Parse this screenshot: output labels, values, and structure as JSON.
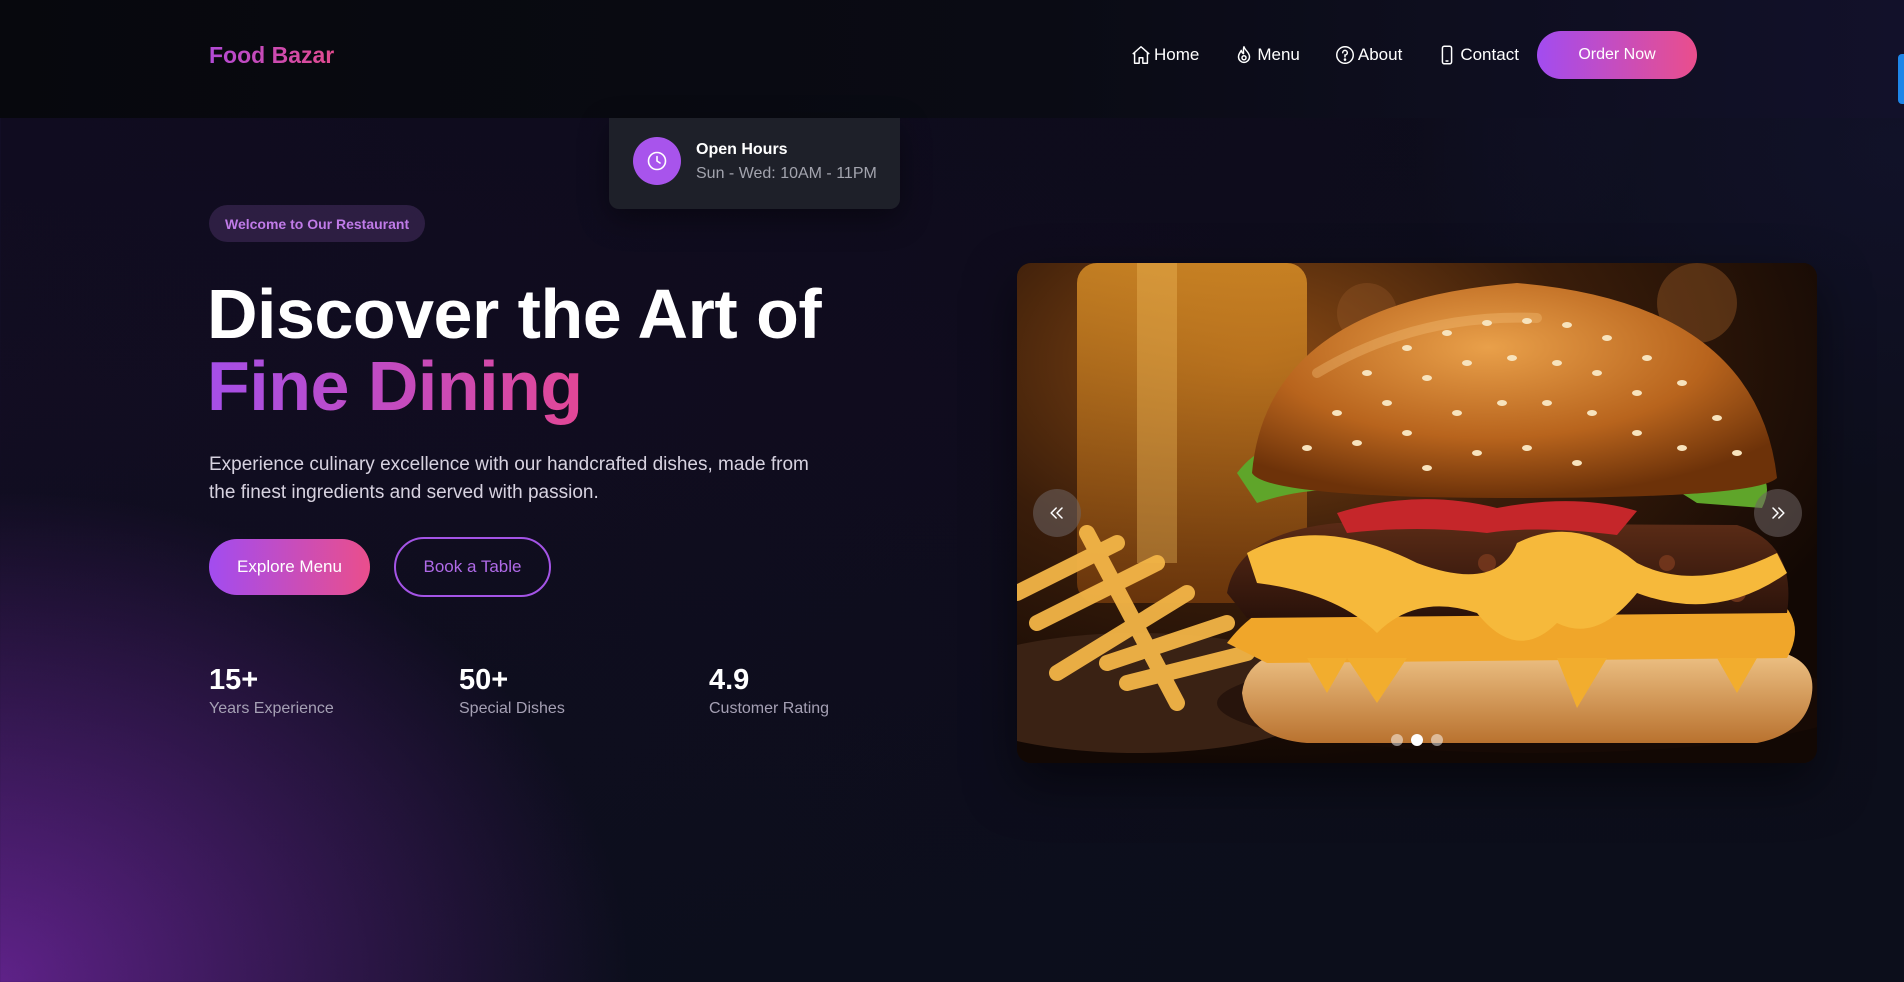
{
  "brand": {
    "name": "Food Bazar",
    "accent_from": "#a24cf0",
    "accent_to": "#ea4e8c"
  },
  "nav": {
    "items": [
      {
        "label": "Home",
        "icon": "home-icon"
      },
      {
        "label": "Menu",
        "icon": "fire-icon"
      },
      {
        "label": "About",
        "icon": "question-icon"
      },
      {
        "label": "Contact",
        "icon": "phone-icon"
      }
    ],
    "cta": "Order Now"
  },
  "hours": {
    "title": "Open Hours",
    "text": "Sun - Wed: 10AM - 11PM",
    "icon": "clock-icon"
  },
  "hero": {
    "badge": "Welcome to Our Restaurant",
    "title_line1": "Discover the Art of",
    "title_line2": "Fine Dining",
    "description": "Experience culinary excellence with our handcrafted dishes, made from the finest ingredients and served with passion.",
    "primary_button": "Explore Menu",
    "secondary_button": "Book a Table"
  },
  "stats": [
    {
      "value": "15+",
      "label": "Years Experience"
    },
    {
      "value": "50+",
      "label": "Special Dishes"
    },
    {
      "value": "4.9",
      "label": "Customer Rating"
    }
  ],
  "slider": {
    "image": "burger-with-fries-photo",
    "prev_icon": "chevrons-left-icon",
    "next_icon": "chevrons-right-icon",
    "slide_count": 3,
    "active_index": 1
  }
}
